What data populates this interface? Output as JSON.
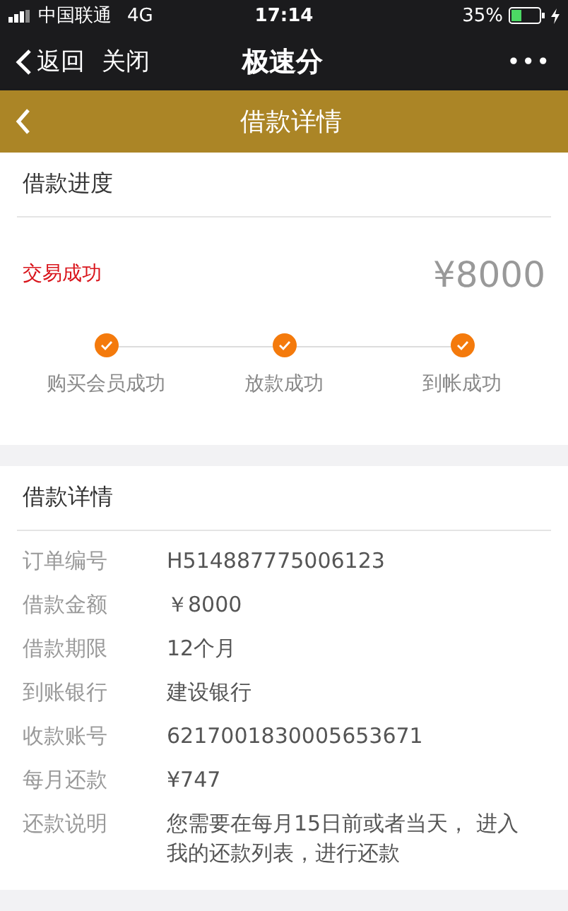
{
  "status_bar": {
    "carrier": "中国联通",
    "network": "4G",
    "time": "17:14",
    "battery": "35%"
  },
  "nav": {
    "back": "返回",
    "close": "关闭",
    "title": "极速分",
    "more": "•••"
  },
  "header": {
    "title": "借款详情"
  },
  "progress": {
    "title": "借款进度",
    "status": "交易成功",
    "amount": "¥8000",
    "steps": [
      {
        "label": "购买会员成功",
        "done": true
      },
      {
        "label": "放款成功",
        "done": true
      },
      {
        "label": "到帐成功",
        "done": true
      }
    ]
  },
  "details": {
    "title": "借款详情",
    "rows": [
      {
        "label": "订单编号",
        "value": "H514887775006123"
      },
      {
        "label": "借款金额",
        "value": "￥8000"
      },
      {
        "label": "借款期限",
        "value": "12个月"
      },
      {
        "label": "到账银行",
        "value": "建设银行"
      },
      {
        "label": "收款账号",
        "value": "6217001830005653671"
      },
      {
        "label": "每月还款",
        "value": "¥747"
      },
      {
        "label": "还款说明",
        "value": "您需要在每月15日前或者当天， 进入我的还款列表，进行还款"
      }
    ]
  }
}
